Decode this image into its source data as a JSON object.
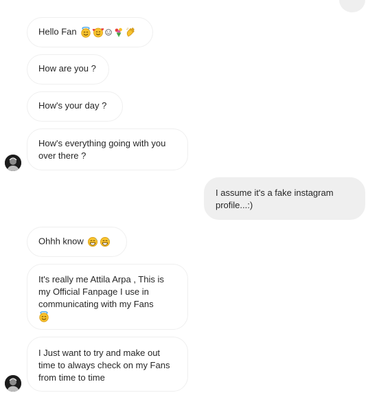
{
  "thread": {
    "messages": [
      {
        "text": "Hello Fan",
        "emojis": [
          "smiling-face-with-halo-icon",
          "smiling-face-with-hearts-icon",
          "slightly-smiling-face-icon",
          "bouquet-icon",
          "clapping-hands-icon"
        ]
      },
      {
        "text": "How are you ?"
      },
      {
        "text": "How's your day ?"
      },
      {
        "text": "How's everything going with you over there ?"
      },
      {
        "text": "I assume it's a fake instagram profile...:)"
      },
      {
        "text": "Ohhh know",
        "emojis": [
          "grinning-face-with-sweat-icon",
          "grinning-face-with-sweat-icon"
        ]
      },
      {
        "text": "It's really me Attila Arpa , This is my Official Fanpage I use in communicating with my Fans",
        "emojis": [
          "smiling-face-with-halo-icon"
        ]
      },
      {
        "text": "I Just want to try and make out time to always check on my Fans from time to time"
      }
    ]
  },
  "colors": {
    "incoming_bubble_bg": "#ffffff",
    "incoming_bubble_border": "#efefef",
    "outgoing_bubble_bg": "#efefef",
    "text": "#262626",
    "emoji_yellow": "#f7c22e"
  }
}
